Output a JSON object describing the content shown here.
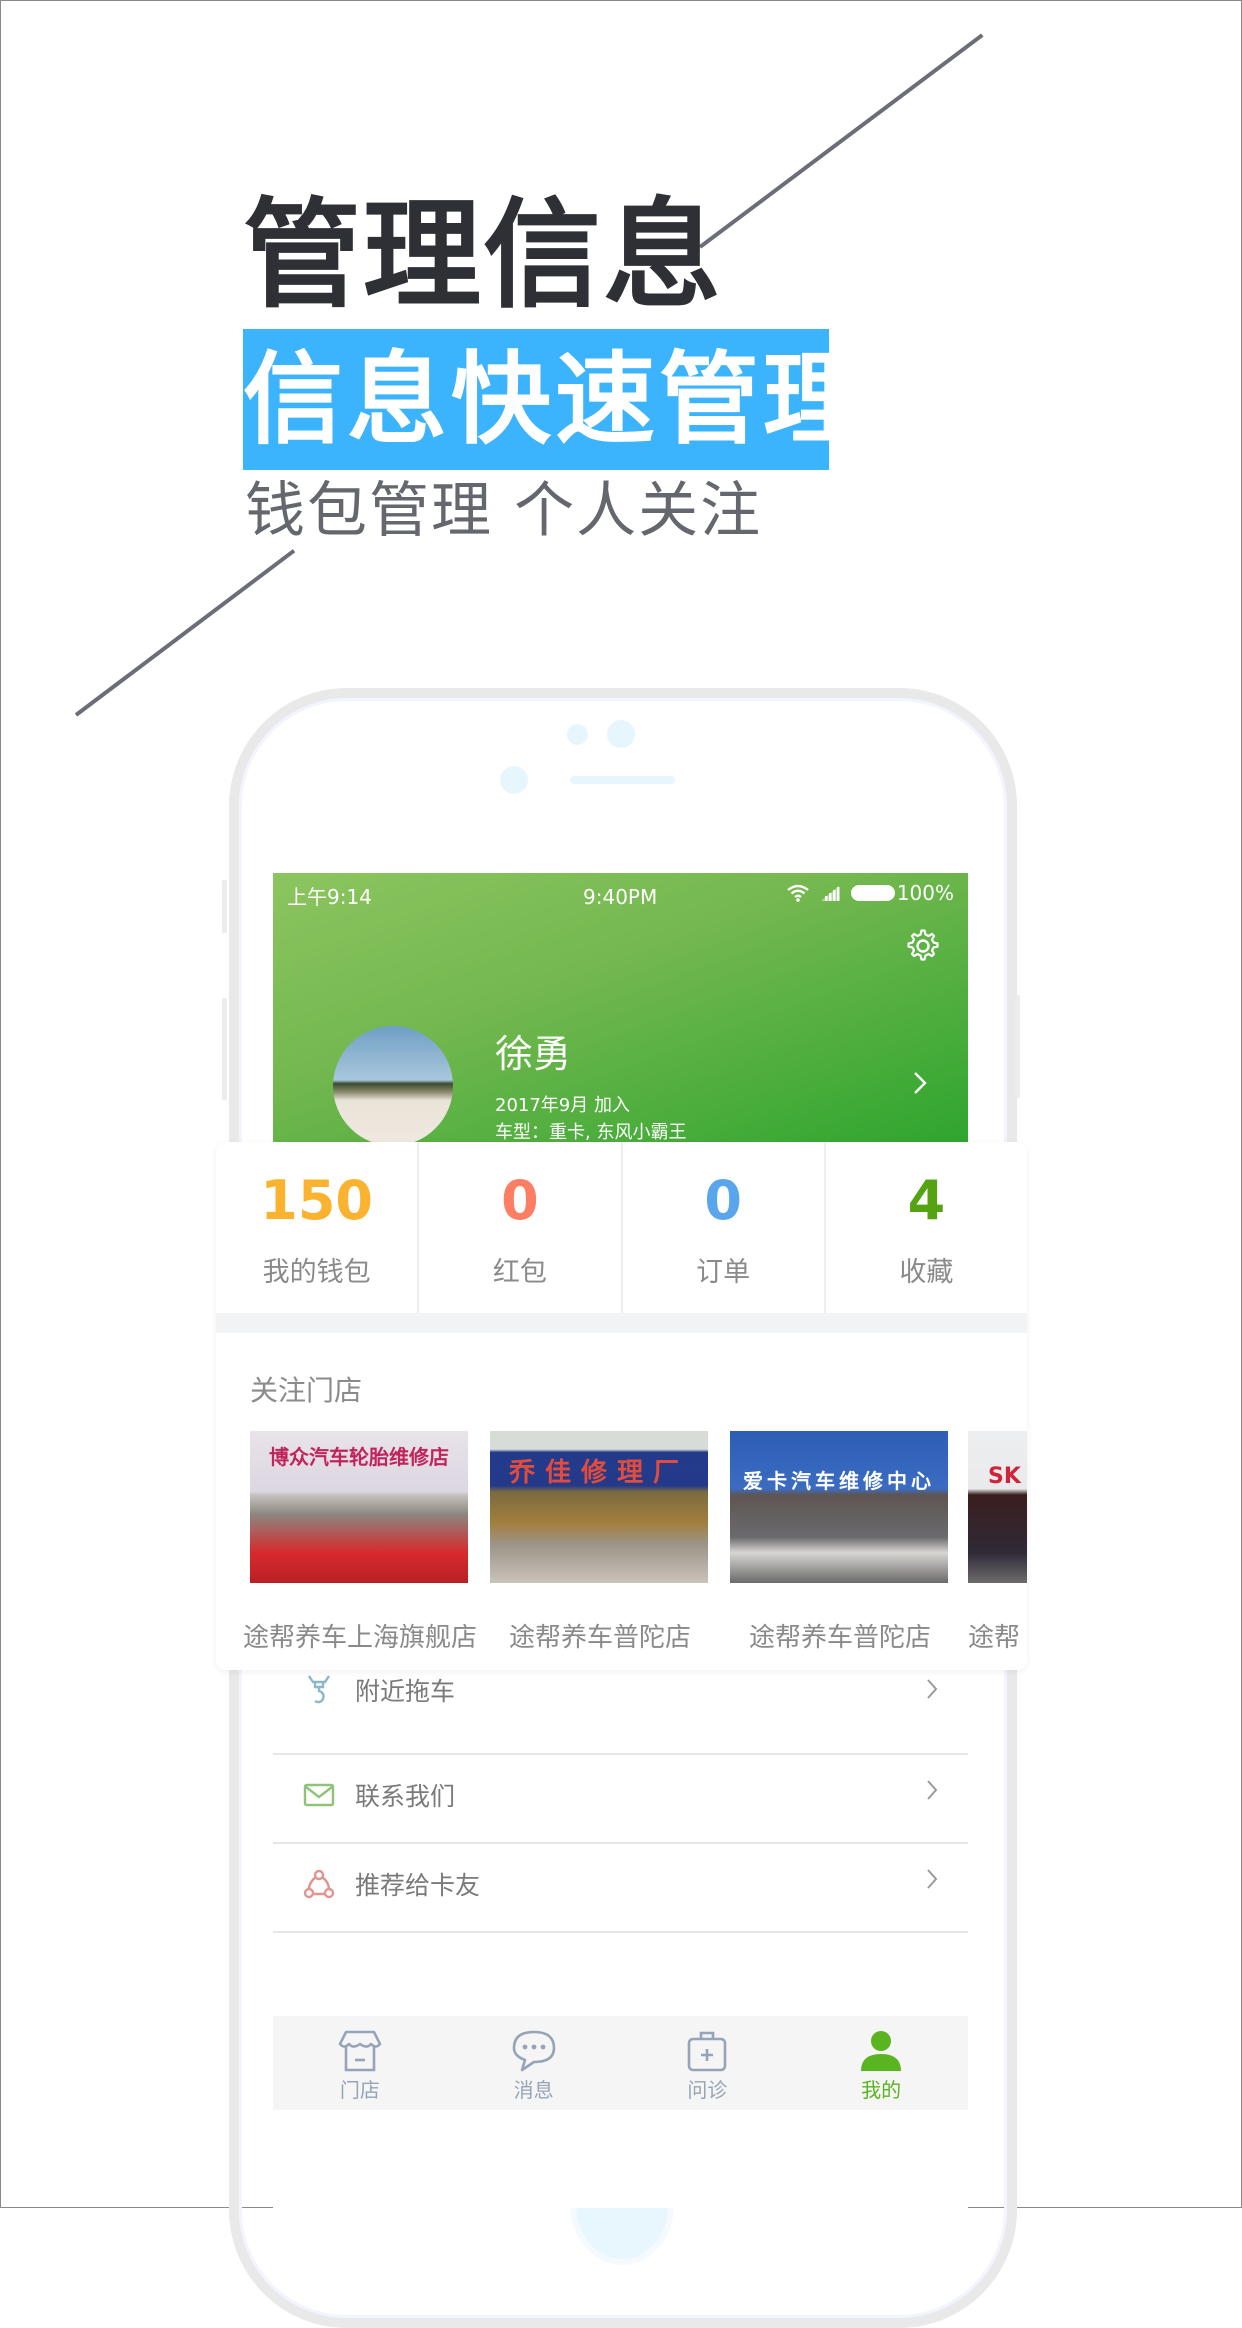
{
  "promo": {
    "headline": "管理信息",
    "banner": "信息快速管理",
    "subline": "钱包管理  个人关注",
    "colors": {
      "headline": "#2f3035",
      "banner_bg": "#3cb3fd",
      "subline": "#65676e"
    }
  },
  "status_bar": {
    "left_time": "上午9:14",
    "center_time": "9:40PM",
    "battery": "100%",
    "icons": [
      "wifi-icon",
      "signal-icon",
      "battery-icon"
    ]
  },
  "profile": {
    "name": "徐勇",
    "join_date": "2017年9月 加入",
    "vehicle": "车型：重卡, 东风小霸王",
    "settings_icon": "gear-icon",
    "header_gradient": [
      "#8cc55f",
      "#2ea52e"
    ]
  },
  "stats": [
    {
      "value": "150",
      "label": "我的钱包",
      "color": "#fbb22e"
    },
    {
      "value": "0",
      "label": "红包",
      "color": "#fd7e63"
    },
    {
      "value": "0",
      "label": "订单",
      "color": "#5aa6ec"
    },
    {
      "value": "4",
      "label": "收藏",
      "color": "#55a312"
    }
  ],
  "followed_stores": {
    "title": "关注门店",
    "items": [
      {
        "name": "途帮养车上海旗舰店",
        "sign": "博众汽车轮胎维修店"
      },
      {
        "name": "途帮养车普陀店",
        "sign": "乔佳修理厂"
      },
      {
        "name": "途帮养车普陀店",
        "sign": "爱卡汽车维修中心"
      },
      {
        "name": "途帮",
        "sign": "SK"
      }
    ]
  },
  "menu": [
    {
      "label": "附近拖车",
      "icon": "tow-hook-icon",
      "color": "#8bb8c9"
    },
    {
      "label": "联系我们",
      "icon": "mail-icon",
      "color": "#8fc27a"
    },
    {
      "label": "推荐给卡友",
      "icon": "share-icon",
      "color": "#e0958f"
    }
  ],
  "tabbar": {
    "active_color": "#5ab420",
    "inactive_color": "#95a4b8",
    "tabs": [
      {
        "label": "门店",
        "icon": "store-icon",
        "active": false
      },
      {
        "label": "消息",
        "icon": "chat-bubble-icon",
        "active": false
      },
      {
        "label": "问诊",
        "icon": "medical-kit-icon",
        "active": false
      },
      {
        "label": "我的",
        "icon": "user-icon",
        "active": true
      }
    ]
  }
}
